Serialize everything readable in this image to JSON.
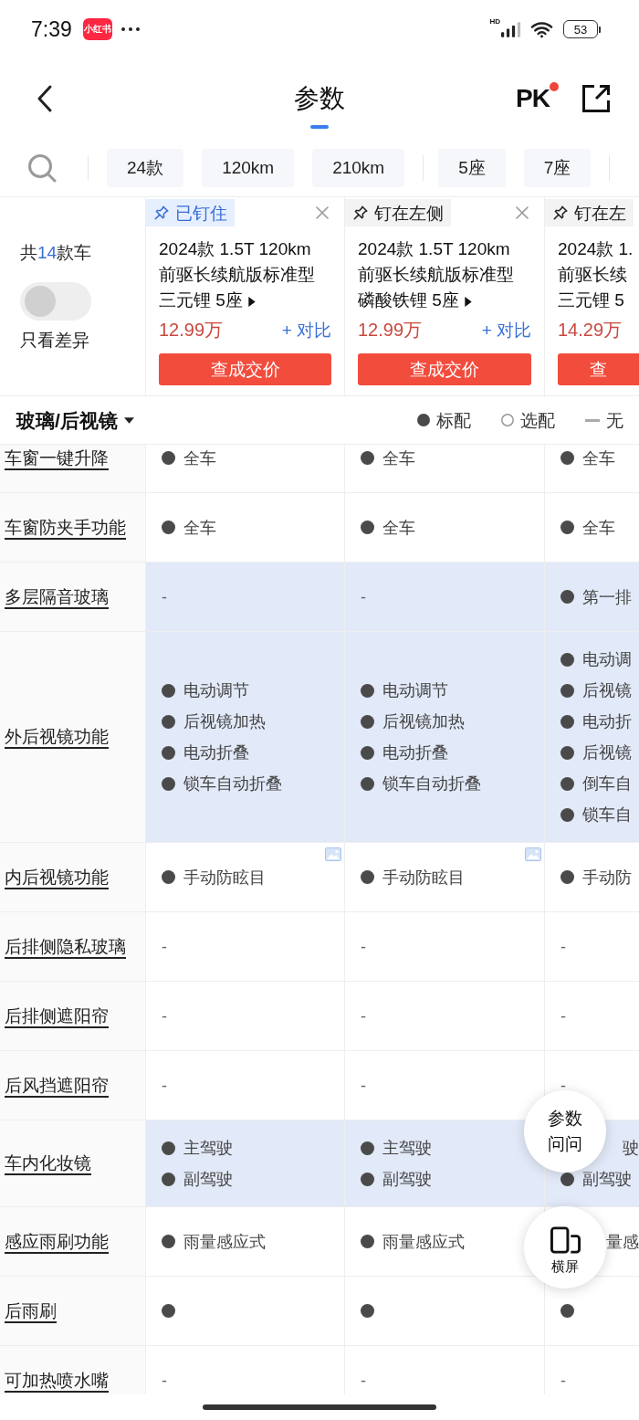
{
  "status_bar": {
    "time": "7:39",
    "app_badge": "小红书",
    "network": "HD",
    "battery": "53"
  },
  "header": {
    "title": "参数",
    "pk": "PK",
    "pk_notification": true
  },
  "filter_groups": [
    {
      "chips": [
        {
          "label": "24款",
          "selected": false
        },
        {
          "label": "120km",
          "selected": false
        },
        {
          "label": "210km",
          "selected": false
        }
      ]
    },
    {
      "chips": [
        {
          "label": "5座",
          "selected": false
        },
        {
          "label": "7座",
          "selected": false
        }
      ]
    }
  ],
  "summary": {
    "prefix": "共",
    "count": "14",
    "suffix": "款车",
    "diff_toggle": {
      "label": "只看差异",
      "on": false
    }
  },
  "cars": [
    {
      "pin_label": "已钉住",
      "pinned": true,
      "close": true,
      "title_lines": [
        "2024款 1.5T 120km",
        "前驱长续航版标准型",
        "三元锂 5座"
      ],
      "detail_arrow": true,
      "price": "12.99万",
      "compare": "+ 对比",
      "price_button": "查成交价"
    },
    {
      "pin_label": "钉在左侧",
      "pinned": false,
      "close": true,
      "title_lines": [
        "2024款 1.5T 120km",
        "前驱长续航版标准型",
        "磷酸铁锂 5座"
      ],
      "detail_arrow": true,
      "price": "12.99万",
      "compare": "+ 对比",
      "price_button": "查成交价"
    },
    {
      "pin_label": "钉在左",
      "pinned": false,
      "close": false,
      "title_lines": [
        "2024款 1.",
        "前驱长续",
        "三元锂 5"
      ],
      "detail_arrow": false,
      "price": "14.29万",
      "price_button": "查"
    }
  ],
  "section": {
    "title": "玻璃/后视镜",
    "legend": [
      {
        "kind": "standard",
        "label": "标配"
      },
      {
        "kind": "optional",
        "label": "选配"
      },
      {
        "kind": "none",
        "label": "无"
      }
    ]
  },
  "rows": [
    {
      "label": "车窗一键升降",
      "differs": false,
      "cells": [
        {
          "items": [
            {
              "kind": "standard",
              "text": "全车"
            }
          ]
        },
        {
          "items": [
            {
              "kind": "standard",
              "text": "全车"
            }
          ]
        },
        {
          "items": [
            {
              "kind": "standard",
              "text": "全车"
            }
          ]
        }
      ]
    },
    {
      "label": "车窗防夹手功能",
      "differs": false,
      "cells": [
        {
          "items": [
            {
              "kind": "standard",
              "text": "全车"
            }
          ]
        },
        {
          "items": [
            {
              "kind": "standard",
              "text": "全车"
            }
          ]
        },
        {
          "items": [
            {
              "kind": "standard",
              "text": "全车"
            }
          ]
        }
      ]
    },
    {
      "label": "多层隔音玻璃",
      "differs": true,
      "cells": [
        {
          "items": [
            {
              "kind": "none",
              "text": "-"
            }
          ]
        },
        {
          "items": [
            {
              "kind": "none",
              "text": "-"
            }
          ]
        },
        {
          "items": [
            {
              "kind": "standard",
              "text": "第一排"
            }
          ]
        }
      ]
    },
    {
      "label": "外后视镜功能",
      "differs": true,
      "cells": [
        {
          "items": [
            {
              "kind": "standard",
              "text": "电动调节"
            },
            {
              "kind": "standard",
              "text": "后视镜加热"
            },
            {
              "kind": "standard",
              "text": "电动折叠"
            },
            {
              "kind": "standard",
              "text": "锁车自动折叠"
            }
          ]
        },
        {
          "items": [
            {
              "kind": "standard",
              "text": "电动调节"
            },
            {
              "kind": "standard",
              "text": "后视镜加热"
            },
            {
              "kind": "standard",
              "text": "电动折叠"
            },
            {
              "kind": "standard",
              "text": "锁车自动折叠"
            }
          ]
        },
        {
          "items": [
            {
              "kind": "standard",
              "text": "电动调"
            },
            {
              "kind": "standard",
              "text": "后视镜"
            },
            {
              "kind": "standard",
              "text": "电动折"
            },
            {
              "kind": "standard",
              "text": "后视镜"
            },
            {
              "kind": "standard",
              "text": "倒车自"
            },
            {
              "kind": "standard",
              "text": "锁车自"
            }
          ]
        }
      ]
    },
    {
      "label": "内后视镜功能",
      "differs": false,
      "cells": [
        {
          "image": true,
          "items": [
            {
              "kind": "standard",
              "text": "手动防眩目"
            }
          ]
        },
        {
          "image": true,
          "items": [
            {
              "kind": "standard",
              "text": "手动防眩目"
            }
          ]
        },
        {
          "items": [
            {
              "kind": "standard",
              "text": "手动防"
            }
          ]
        }
      ]
    },
    {
      "label": "后排侧隐私玻璃",
      "differs": false,
      "cells": [
        {
          "items": [
            {
              "kind": "none",
              "text": "-"
            }
          ]
        },
        {
          "items": [
            {
              "kind": "none",
              "text": "-"
            }
          ]
        },
        {
          "items": [
            {
              "kind": "none",
              "text": "-"
            }
          ]
        }
      ]
    },
    {
      "label": "后排侧遮阳帘",
      "differs": false,
      "cells": [
        {
          "items": [
            {
              "kind": "none",
              "text": "-"
            }
          ]
        },
        {
          "items": [
            {
              "kind": "none",
              "text": "-"
            }
          ]
        },
        {
          "items": [
            {
              "kind": "none",
              "text": "-"
            }
          ]
        }
      ]
    },
    {
      "label": "后风挡遮阳帘",
      "differs": false,
      "cells": [
        {
          "items": [
            {
              "kind": "none",
              "text": "-"
            }
          ]
        },
        {
          "items": [
            {
              "kind": "none",
              "text": "-"
            }
          ]
        },
        {
          "items": [
            {
              "kind": "none",
              "text": "-"
            }
          ]
        }
      ]
    },
    {
      "label": "车内化妆镜",
      "differs": true,
      "cells": [
        {
          "items": [
            {
              "kind": "standard",
              "text": "主驾驶"
            },
            {
              "kind": "standard",
              "text": "副驾驶"
            }
          ]
        },
        {
          "items": [
            {
              "kind": "standard",
              "text": "主驾驶"
            },
            {
              "kind": "standard",
              "text": "副驾驶"
            }
          ]
        },
        {
          "items": [
            {
              "kind": "partial",
              "text": "驶"
            },
            {
              "kind": "standard",
              "text": "副驾驶"
            }
          ]
        }
      ]
    },
    {
      "label": "感应雨刷功能",
      "differs": false,
      "cells": [
        {
          "items": [
            {
              "kind": "standard",
              "text": "雨量感应式"
            }
          ]
        },
        {
          "items": [
            {
              "kind": "standard",
              "text": "雨量感应式"
            }
          ]
        },
        {
          "items": [
            {
              "kind": "partial",
              "text": "量感"
            }
          ]
        }
      ]
    },
    {
      "label": "后雨刷",
      "differs": false,
      "cells": [
        {
          "items": [
            {
              "kind": "standard"
            }
          ]
        },
        {
          "items": [
            {
              "kind": "standard"
            }
          ]
        },
        {
          "items": [
            {
              "kind": "standard"
            }
          ]
        }
      ]
    },
    {
      "label": "可加热喷水嘴",
      "differs": false,
      "cells": [
        {
          "items": [
            {
              "kind": "none",
              "text": "-"
            }
          ]
        },
        {
          "items": [
            {
              "kind": "none",
              "text": "-"
            }
          ]
        },
        {
          "items": [
            {
              "kind": "none",
              "text": "-"
            }
          ]
        }
      ]
    }
  ],
  "floating_buttons": [
    {
      "kind": "text",
      "label": "参数问问"
    },
    {
      "kind": "rotate",
      "label": "横屏"
    }
  ]
}
